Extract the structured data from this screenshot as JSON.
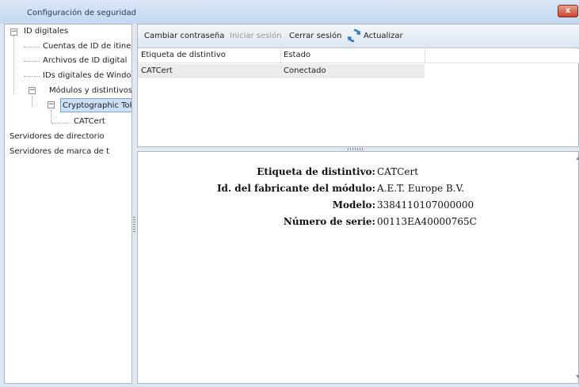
{
  "window": {
    "title": "Configuración de seguridad",
    "close_icon": "close-icon",
    "close_label": "x"
  },
  "tree": {
    "items": [
      {
        "label": "ID digitales"
      },
      {
        "label": "Cuentas de ID de itine"
      },
      {
        "label": "Archivos de ID digital"
      },
      {
        "label": "IDs digitales de Windo"
      },
      {
        "label": "Módulos y distintivos"
      },
      {
        "label": "Cryptographic Tok"
      },
      {
        "label": "CATCert"
      },
      {
        "label": "Servidores de directorio"
      },
      {
        "label": "Servidores de marca de t"
      }
    ]
  },
  "toolbar": {
    "change_password": "Cambiar contraseña",
    "login": "Iniciar sesión",
    "logout": "Cerrar sesión",
    "refresh": "Actualizar"
  },
  "table": {
    "headers": [
      "Etiqueta de distintivo",
      "Estado"
    ],
    "rows": [
      [
        "CATCert",
        "Conectado"
      ]
    ]
  },
  "details": [
    {
      "label": "Etiqueta de distintivo:",
      "value": "CATCert"
    },
    {
      "label": "Id. del fabricante del módulo:",
      "value": "A.E.T. Europe B.V."
    },
    {
      "label": "Modelo:",
      "value": "3384110107000000"
    },
    {
      "label": "Número de serie:",
      "value": "00113EA40000765C"
    }
  ],
  "colors": {
    "selection": "#cde0f7",
    "title_bar": "#c5d8ef",
    "close_button": "#c7452d"
  }
}
